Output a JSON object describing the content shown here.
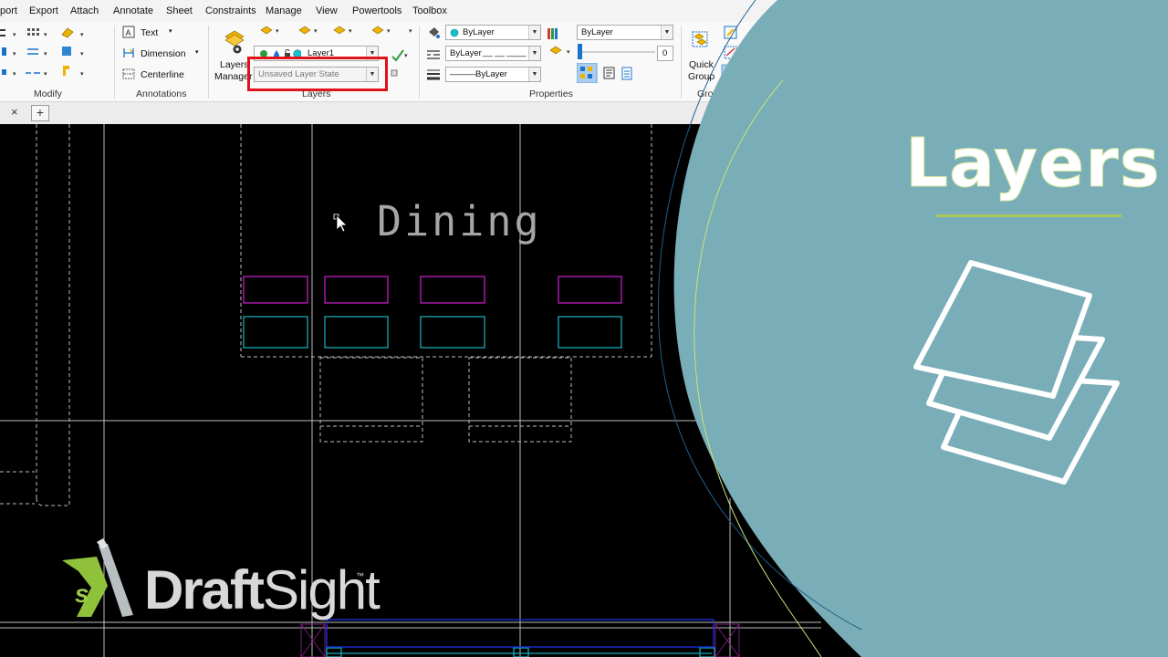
{
  "menu": [
    "port",
    "Export",
    "Attach",
    "Annotate",
    "Sheet",
    "Constraints",
    "Manage",
    "View",
    "Powertools",
    "Toolbox"
  ],
  "ribbon": {
    "groups": {
      "modify": "Modify",
      "annotations": "Annotations",
      "layers": "Layers",
      "properties": "Properties",
      "groups": "Groups"
    },
    "annotations": {
      "text": "Text",
      "dimension": "Dimension",
      "centerline": "Centerline"
    },
    "layers": {
      "manager_line1": "Layers",
      "manager_line2": "Manager",
      "current_layer": "Layer1",
      "layer_state": "Unsaved Layer State"
    },
    "properties": {
      "color": "ByLayer",
      "linetype": "ByLayer",
      "linetype_pattern": "__ __ ____",
      "lineweight": "ByLayer",
      "lineweight_sample": "———",
      "print_style": "ByLayer",
      "transparency_value": "0"
    },
    "groups_panel": {
      "quick_group_line1": "Quick",
      "quick_group_line2": "Group"
    }
  },
  "tabs": {
    "close": "×",
    "add": "+"
  },
  "canvas": {
    "room_label": "Dining"
  },
  "logo": {
    "draft": "Draft",
    "sight": "Sight",
    "tm": "™"
  },
  "panel": {
    "title": "Layers"
  },
  "colors": {
    "panel": "#79adb7",
    "highlight": "#e0121a",
    "magenta": "#c21bc2",
    "cyan": "#1aa8b4",
    "accent_green": "#a8c95a"
  }
}
